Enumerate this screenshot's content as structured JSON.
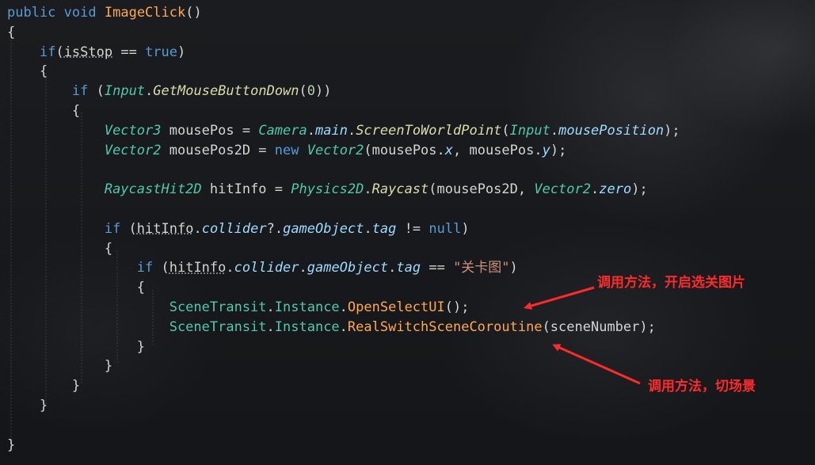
{
  "code_lines": [
    [
      [
        "kw",
        "public"
      ],
      [
        "pl",
        " "
      ],
      [
        "kw",
        "void"
      ],
      [
        "pl",
        " "
      ],
      [
        "fn",
        "ImageClick"
      ],
      [
        "pl",
        "()"
      ]
    ],
    [
      [
        "pl",
        "{"
      ]
    ],
    [
      [
        "pl",
        "    "
      ],
      [
        "kw",
        "if"
      ],
      [
        "pl",
        "("
      ],
      [
        "dot",
        "isStop"
      ],
      [
        "pl",
        " == "
      ],
      [
        "kw",
        "true"
      ],
      [
        "pl",
        ")"
      ]
    ],
    [
      [
        "pl",
        "    {"
      ]
    ],
    [
      [
        "pl",
        "        "
      ],
      [
        "kw",
        "if"
      ],
      [
        "pl",
        " ("
      ],
      [
        "tp",
        "Input"
      ],
      [
        "pl",
        "."
      ],
      [
        "mtf",
        "GetMouseButtonDown"
      ],
      [
        "pl",
        "("
      ],
      [
        "nm",
        "0"
      ],
      [
        "pl",
        "))"
      ]
    ],
    [
      [
        "pl",
        "        {"
      ]
    ],
    [
      [
        "pl",
        "            "
      ],
      [
        "tp",
        "Vector3"
      ],
      [
        "pl",
        " mousePos = "
      ],
      [
        "tp",
        "Camera"
      ],
      [
        "pl",
        "."
      ],
      [
        "pr",
        "main"
      ],
      [
        "pl",
        "."
      ],
      [
        "mtf",
        "ScreenToWorldPoint"
      ],
      [
        "pl",
        "("
      ],
      [
        "tp",
        "Input"
      ],
      [
        "pl",
        "."
      ],
      [
        "pr",
        "mousePosition"
      ],
      [
        "pl",
        ");"
      ]
    ],
    [
      [
        "pl",
        "            "
      ],
      [
        "tp",
        "Vector2"
      ],
      [
        "pl",
        " mousePos2D = "
      ],
      [
        "kw",
        "new"
      ],
      [
        "pl",
        " "
      ],
      [
        "tp",
        "Vector2"
      ],
      [
        "pl",
        "(mousePos."
      ],
      [
        "pr",
        "x"
      ],
      [
        "pl",
        ", mousePos."
      ],
      [
        "pr",
        "y"
      ],
      [
        "pl",
        ");"
      ]
    ],
    [
      [
        "pl",
        ""
      ]
    ],
    [
      [
        "pl",
        "            "
      ],
      [
        "tp",
        "RaycastHit2D"
      ],
      [
        "pl",
        " hitInfo = "
      ],
      [
        "tp",
        "Physics2D"
      ],
      [
        "pl",
        "."
      ],
      [
        "mtf",
        "Raycast"
      ],
      [
        "pl",
        "(mousePos2D, "
      ],
      [
        "tp",
        "Vector2"
      ],
      [
        "pl",
        "."
      ],
      [
        "pr",
        "zero"
      ],
      [
        "pl",
        ");"
      ]
    ],
    [
      [
        "pl",
        ""
      ]
    ],
    [
      [
        "pl",
        "            "
      ],
      [
        "kw",
        "if"
      ],
      [
        "pl",
        " ("
      ],
      [
        "dot",
        "hitInfo"
      ],
      [
        "pl",
        "."
      ],
      [
        "pr",
        "collider"
      ],
      [
        "pl",
        "?."
      ],
      [
        "pr",
        "gameObject"
      ],
      [
        "pl",
        "."
      ],
      [
        "pr",
        "tag"
      ],
      [
        "pl",
        " != "
      ],
      [
        "kw",
        "null"
      ],
      [
        "pl",
        ")"
      ]
    ],
    [
      [
        "pl",
        "            {"
      ]
    ],
    [
      [
        "pl",
        "                "
      ],
      [
        "kw",
        "if"
      ],
      [
        "pl",
        " ("
      ],
      [
        "dot",
        "hitInfo"
      ],
      [
        "pl",
        "."
      ],
      [
        "pr",
        "collider"
      ],
      [
        "pl",
        "."
      ],
      [
        "pr",
        "gameObject"
      ],
      [
        "pl",
        "."
      ],
      [
        "pr",
        "tag"
      ],
      [
        "pl",
        " == "
      ],
      [
        "st",
        "\"关卡图\""
      ],
      [
        "pl",
        ")"
      ]
    ],
    [
      [
        "pl",
        "                {"
      ]
    ],
    [
      [
        "pl",
        "                    "
      ],
      [
        "cls",
        "SceneTransit"
      ],
      [
        "pl",
        "."
      ],
      [
        "cls",
        "Instance"
      ],
      [
        "pl",
        "."
      ],
      [
        "fn",
        "OpenSelectUI"
      ],
      [
        "pl",
        "();"
      ]
    ],
    [
      [
        "pl",
        "                    "
      ],
      [
        "cls",
        "SceneTransit"
      ],
      [
        "pl",
        "."
      ],
      [
        "cls",
        "Instance"
      ],
      [
        "pl",
        "."
      ],
      [
        "fn",
        "RealSwitchSceneCoroutine"
      ],
      [
        "pl",
        "(sceneNumber);"
      ]
    ],
    [
      [
        "pl",
        "                }"
      ]
    ],
    [
      [
        "pl",
        "            }"
      ]
    ],
    [
      [
        "pl",
        "        }"
      ]
    ],
    [
      [
        "pl",
        "    }"
      ]
    ],
    [
      [
        "pl",
        ""
      ]
    ],
    [
      [
        "pl",
        "}"
      ]
    ]
  ],
  "annotations": {
    "open_select": "调用方法，开启选关图片",
    "switch_scene": "调用方法，切场景"
  },
  "colors": {
    "keyword": "#569cd6",
    "type": "#4ec9b0",
    "method_highlight": "#ffa94d",
    "annotation": "#ff2a2a"
  }
}
